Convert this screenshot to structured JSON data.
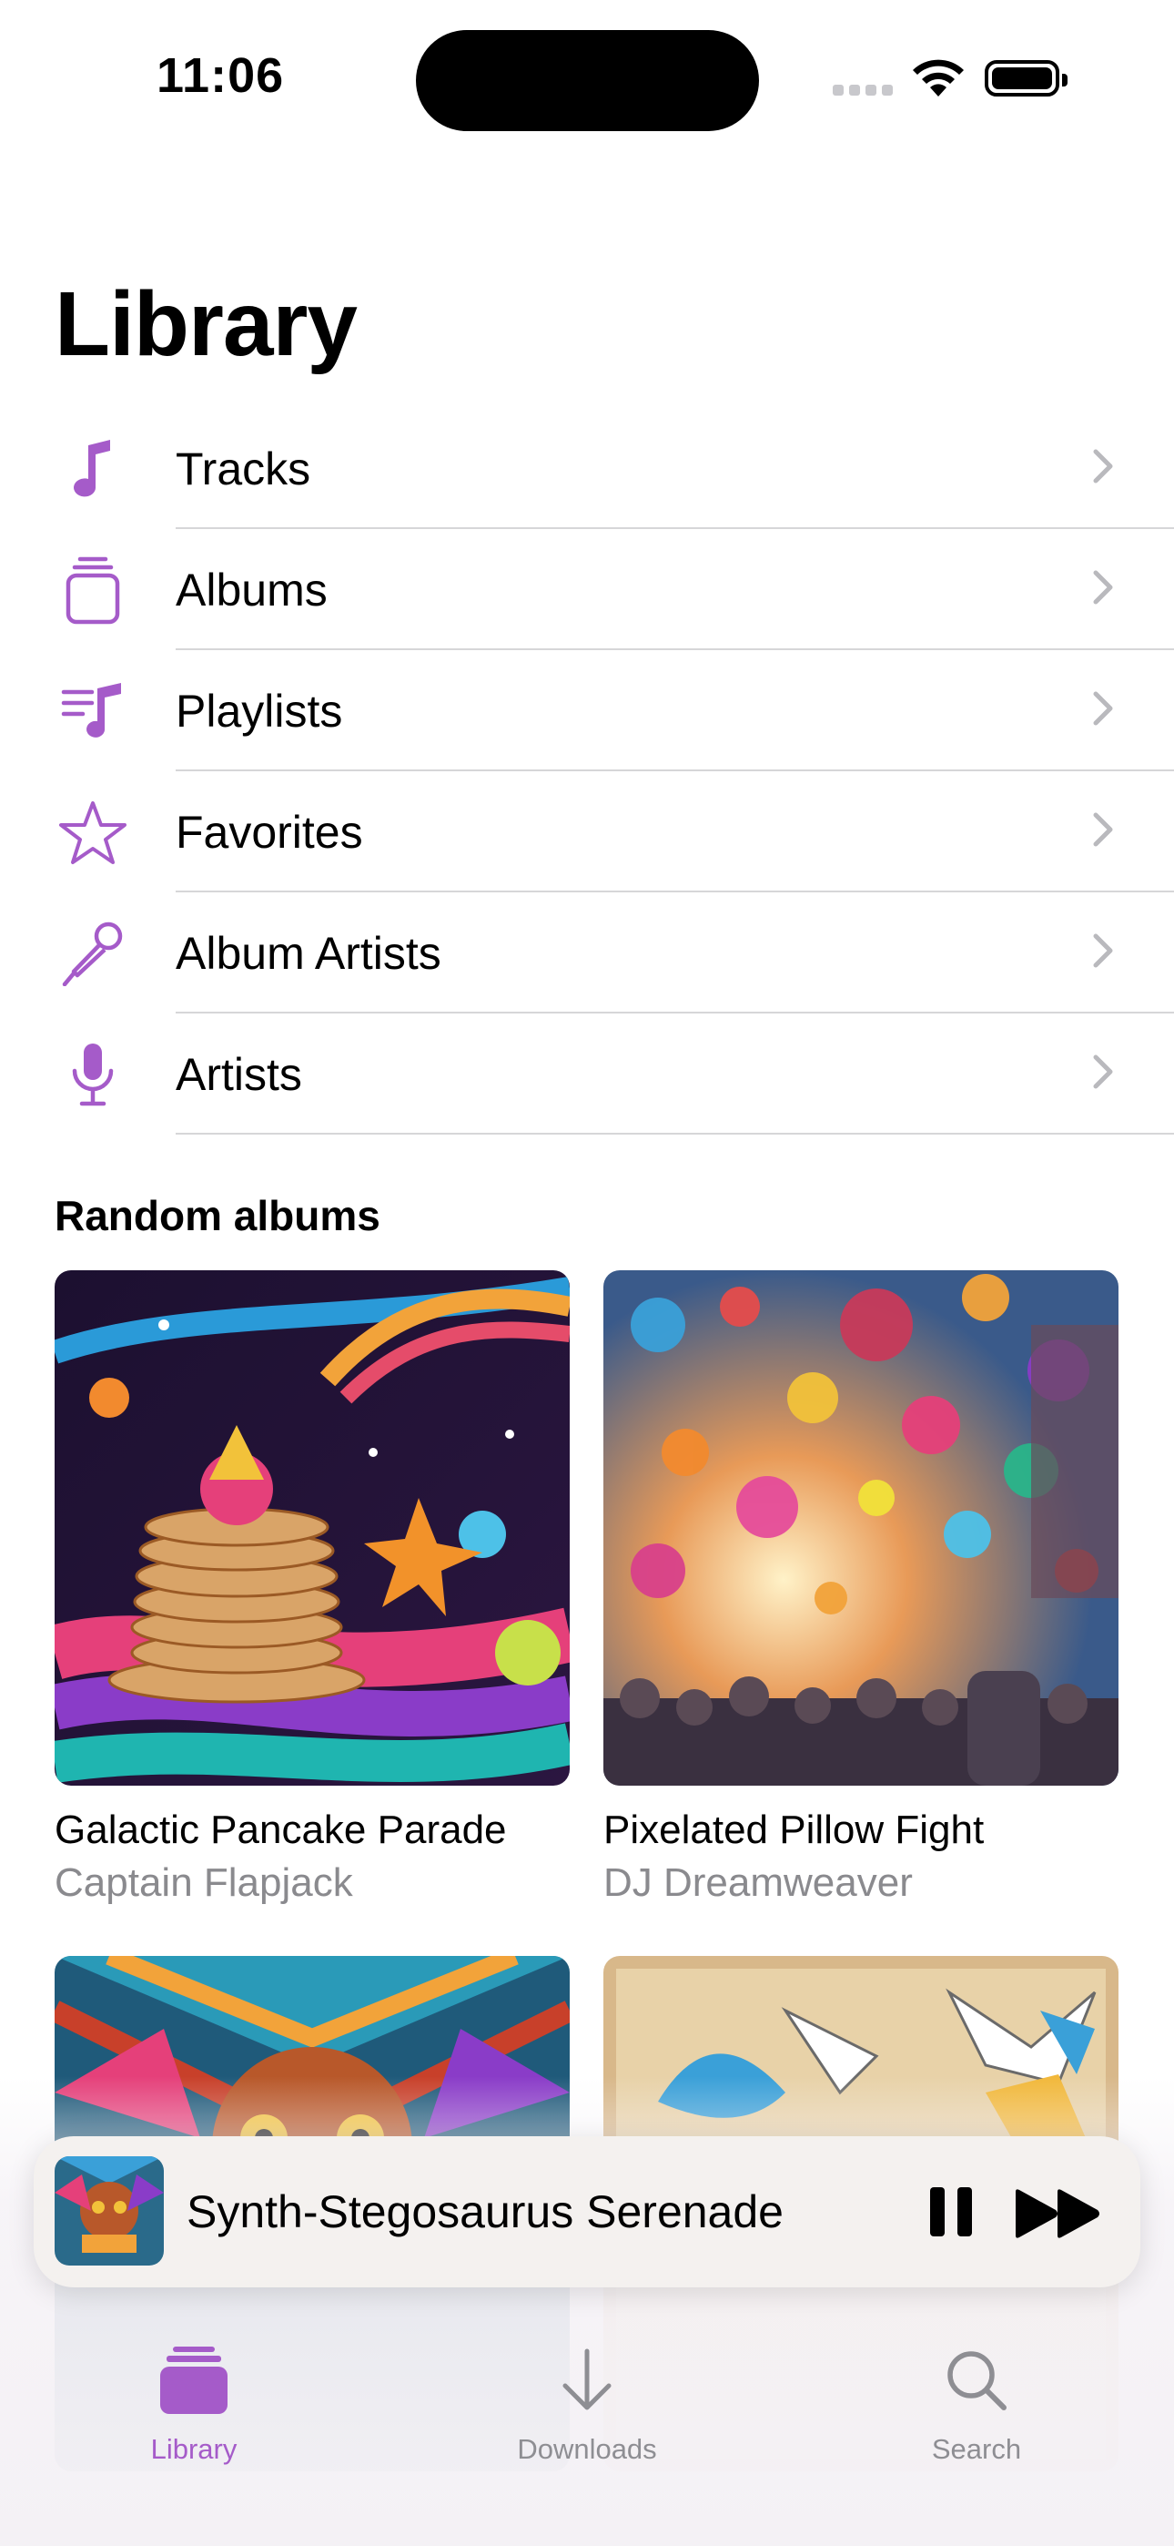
{
  "status": {
    "time": "11:06"
  },
  "title": "Library",
  "menu": [
    {
      "label": "Tracks",
      "icon": "music-note-icon"
    },
    {
      "label": "Albums",
      "icon": "album-stack-icon"
    },
    {
      "label": "Playlists",
      "icon": "playlist-icon"
    },
    {
      "label": "Favorites",
      "icon": "star-icon"
    },
    {
      "label": "Album Artists",
      "icon": "microphone-stand-icon"
    },
    {
      "label": "Artists",
      "icon": "microphone-icon"
    }
  ],
  "random_albums": {
    "title": "Random albums",
    "items": [
      {
        "title": "Galactic Pancake Parade",
        "artist": "Captain Flapjack"
      },
      {
        "title": "Pixelated Pillow Fight",
        "artist": "DJ Dreamweaver"
      }
    ]
  },
  "now_playing": {
    "title": "Synth-Stegosaurus Serenade"
  },
  "tabs": [
    {
      "label": "Library",
      "active": true
    },
    {
      "label": "Downloads",
      "active": false
    },
    {
      "label": "Search",
      "active": false
    }
  ],
  "colors": {
    "accent": "#a55bc9",
    "separator": "#d6d6d8",
    "secondary_text": "#8a8a8e"
  }
}
